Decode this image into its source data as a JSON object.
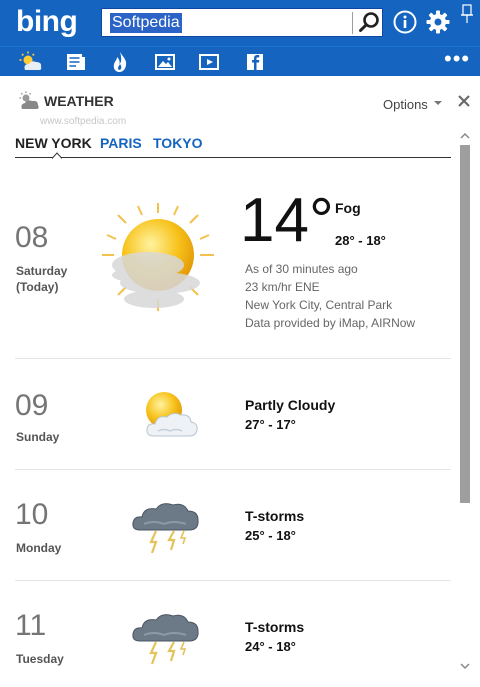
{
  "header": {
    "logo": "bing",
    "search_value": "Softpedia",
    "icons": [
      "search-icon",
      "info-icon",
      "gear-icon",
      "pin-icon"
    ]
  },
  "toolbar": {
    "tabs": [
      "weather-icon",
      "news-icon",
      "trending-icon",
      "images-icon",
      "video-icon",
      "facebook-icon"
    ],
    "more_label": "•••"
  },
  "weather": {
    "title": "WEATHER",
    "watermark": "www.softpedia.com",
    "options_label": "Options",
    "cities": [
      "NEW YORK",
      "PARIS",
      "TOKYO"
    ],
    "active_city": "NEW YORK",
    "today": {
      "day_num": "08",
      "day_name": "Saturday",
      "day_sub": "(Today)",
      "temp": "14°",
      "condition": "Fog",
      "range": "28° - 18°",
      "details": [
        "As of 30 minutes ago",
        "23 km/hr ENE",
        "New York City, Central Park",
        "Data provided by iMap, AIRNow"
      ]
    },
    "forecast": [
      {
        "day_num": "09",
        "day_name": "Sunday",
        "condition": "Partly Cloudy",
        "range": "27° - 17°"
      },
      {
        "day_num": "10",
        "day_name": "Monday",
        "condition": "T-storms",
        "range": "25° - 18°"
      },
      {
        "day_num": "11",
        "day_name": "Tuesday",
        "condition": "T-storms",
        "range": "24° - 18°"
      }
    ]
  },
  "colors": {
    "brand_blue": "#1565c0",
    "link_blue": "#1565c0",
    "selection": "#2b63c6"
  }
}
